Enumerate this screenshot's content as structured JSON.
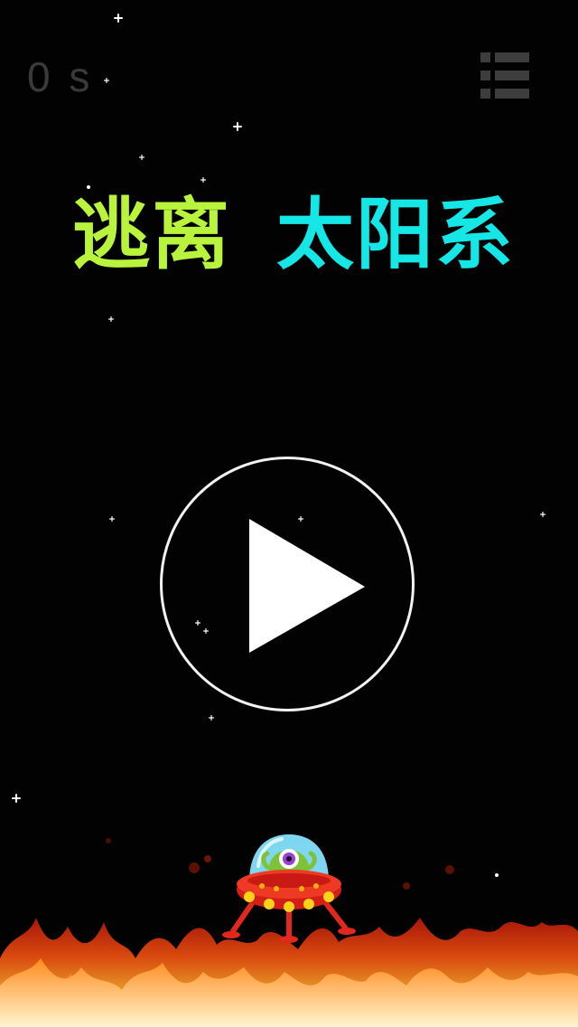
{
  "hud": {
    "timer_value": "0 s",
    "menu_icon": "list-menu-icon"
  },
  "title": {
    "part_a": "逃离",
    "part_b": "太阳系",
    "color_a": "#b9f33c",
    "color_b": "#15e6e6"
  },
  "play_button": {
    "icon": "play-icon"
  },
  "player": {
    "sprite": "alien-ufo-icon"
  },
  "hazard": {
    "sprite": "fire-icon"
  }
}
